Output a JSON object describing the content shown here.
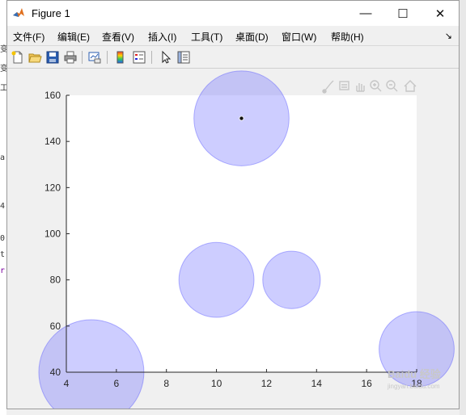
{
  "window": {
    "title": "Figure 1",
    "minimize": "—",
    "maximize": "☐",
    "close": "✕"
  },
  "menu": [
    {
      "label": "文件(F)"
    },
    {
      "label": "编辑(E)"
    },
    {
      "label": "查看(V)"
    },
    {
      "label": "插入(I)"
    },
    {
      "label": "工具(T)"
    },
    {
      "label": "桌面(D)"
    },
    {
      "label": "窗口(W)"
    },
    {
      "label": "帮助(H)"
    }
  ],
  "toolbar": [
    "new-figure-icon",
    "open-file-icon",
    "save-icon",
    "print-icon",
    "link-plot-icon",
    "insert-colorbar-icon",
    "insert-legend-icon",
    "edit-plot-icon",
    "property-inspector-icon"
  ],
  "axes_toolbar": [
    "brush-icon",
    "data-tip-icon",
    "pan-icon",
    "zoom-in-icon",
    "zoom-out-icon",
    "home-icon"
  ],
  "background_text": [
    "变",
    "变",
    "工",
    "a",
    "4",
    "0",
    "t",
    "r"
  ],
  "colors": {
    "bubble_fill": "#6f6fff",
    "bubble_stroke": "#5a5aff",
    "axes_bg": "#ffffff",
    "figure_bg": "#f0f0f0"
  },
  "chart_data": {
    "type": "scatter",
    "xlim": [
      4,
      18
    ],
    "ylim": [
      40,
      160
    ],
    "xticks": [
      "4",
      "6",
      "8",
      "10",
      "12",
      "14",
      "16",
      "18"
    ],
    "yticks": [
      "40",
      "60",
      "80",
      "100",
      "120",
      "140",
      "160"
    ],
    "points": [
      {
        "x": 11,
        "y": 150,
        "radius_x": 1.9,
        "marker": true
      },
      {
        "x": 10,
        "y": 80,
        "radius_x": 1.5
      },
      {
        "x": 13,
        "y": 80,
        "radius_x": 1.15
      },
      {
        "x": 5,
        "y": 40,
        "radius_x": 2.1
      },
      {
        "x": 18,
        "y": 50,
        "radius_x": 1.5
      }
    ],
    "grid": false
  },
  "watermark": {
    "text": "Baidu 经验",
    "sub": "jingyan.baidu.com"
  }
}
